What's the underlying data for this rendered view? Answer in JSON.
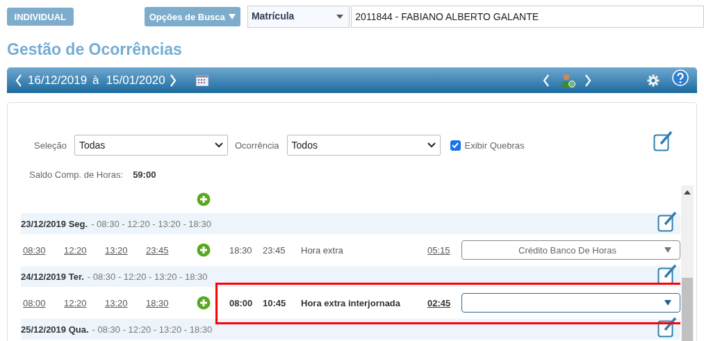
{
  "top_bar": {
    "mode_button": "INDIVIDUAL",
    "search_options_button": "Opções de Busca",
    "key_select": "Matrícula",
    "employee_field": "2011844 - FABIANO ALBERTO GALANTE"
  },
  "page_title": "Gestão de Ocorrências",
  "period_bar": {
    "start": "16/12/2019",
    "separator": "à",
    "end": "15/01/2020"
  },
  "filters": {
    "selection_label": "Seleção",
    "selection_value": "Todas",
    "occurrence_label": "Ocorrência",
    "occurrence_value": "Todos",
    "show_breaks": {
      "label": "Exibir Quebras",
      "checked": true
    }
  },
  "balance": {
    "label": "Saldo Comp. de Horas:",
    "value": "59:00"
  },
  "days": [
    {
      "date": "23/12/2019 Seg.",
      "schedule": "- 08:30 - 12:20 - 13:20 - 18:30",
      "punches": [
        "08:30",
        "12:20",
        "13:20",
        "23:45"
      ],
      "occurrence": {
        "start": "18:30",
        "end": "23:45",
        "type": "Hora extra",
        "duration": "05:15",
        "action": "Crédito Banco De Horas",
        "highlighted": false
      }
    },
    {
      "date": "24/12/2019 Ter.",
      "schedule": "- 08:30 - 12:20 - 13:20 - 18:30",
      "punches": [
        "08:00",
        "12:20",
        "13:20",
        "18:30"
      ],
      "occurrence": {
        "start": "08:00",
        "end": "10:45",
        "type": "Hora extra interjornada",
        "duration": "02:45",
        "highlighted": true
      }
    },
    {
      "date": "25/12/2019 Qua.",
      "schedule": "- 08:30 - 12:20 - 13:20 - 18:30"
    }
  ]
}
